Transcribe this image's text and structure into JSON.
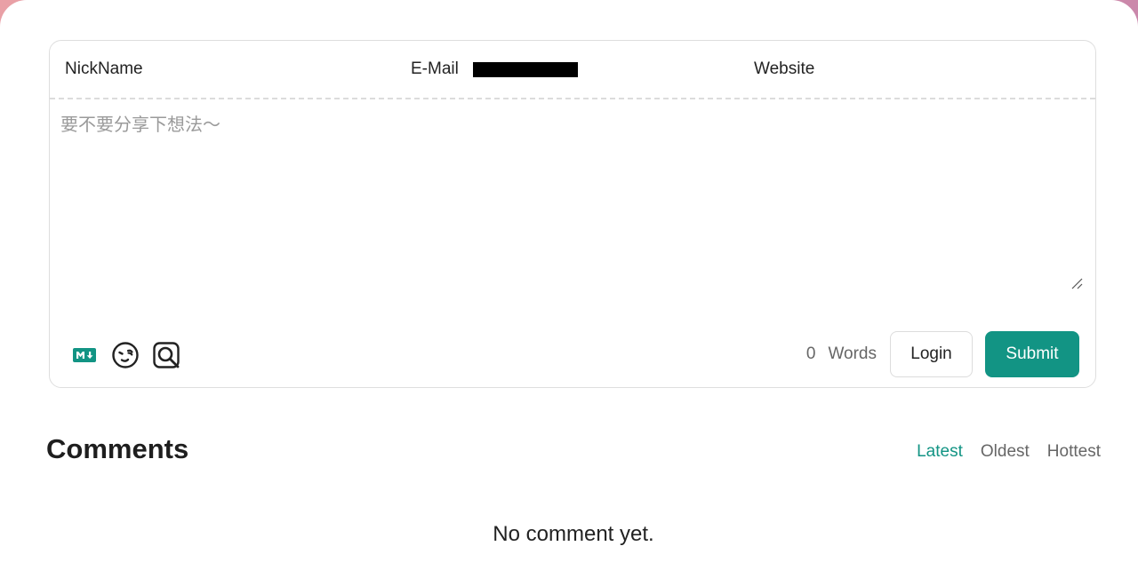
{
  "form": {
    "nickname_label": "NickName",
    "email_label": "E-Mail",
    "website_label": "Website",
    "textarea_placeholder": "要不要分享下想法～",
    "word_count": "0",
    "word_label": "Words",
    "login_label": "Login",
    "submit_label": "Submit",
    "toolbar_icons": [
      "markdown-icon",
      "emoji-icon",
      "preview-icon"
    ]
  },
  "comments": {
    "title": "Comments",
    "sort": {
      "latest": "Latest",
      "oldest": "Oldest",
      "hottest": "Hottest",
      "active": "Latest"
    },
    "empty_text": "No comment yet."
  },
  "colors": {
    "accent": "#129484"
  }
}
